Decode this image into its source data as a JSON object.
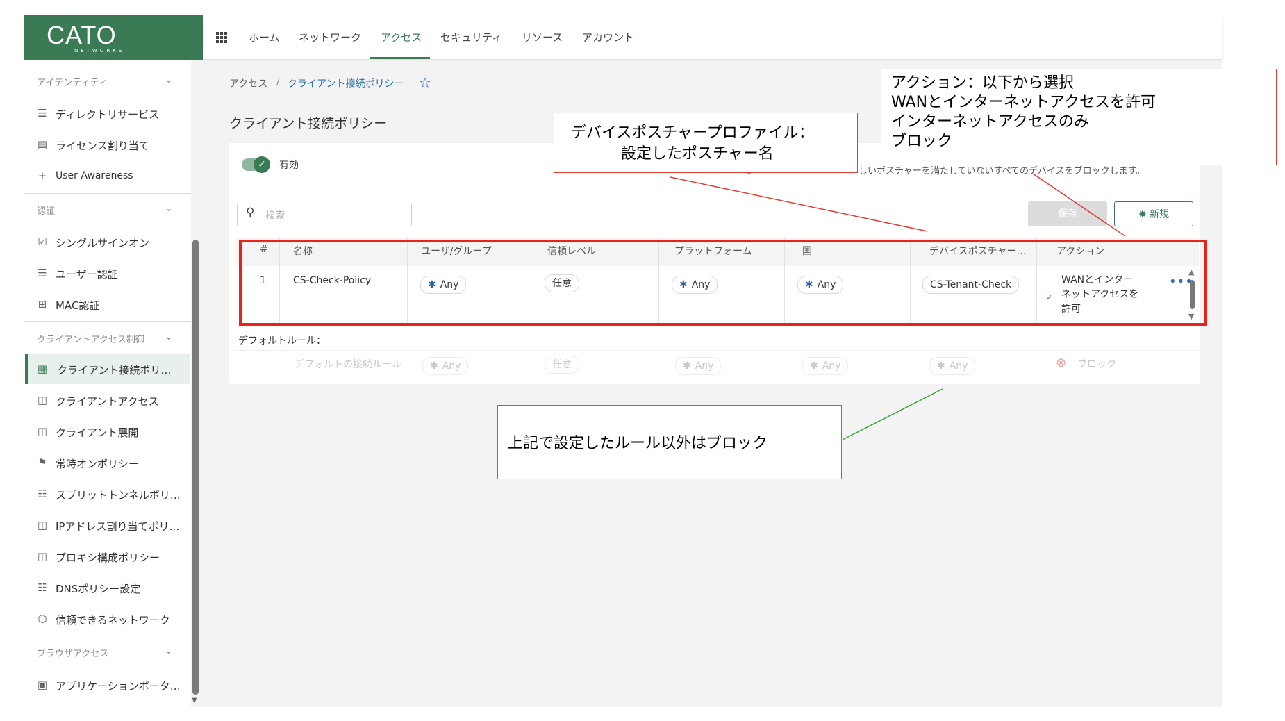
{
  "brand": {
    "name": "CATO",
    "sub": "NETWORKS",
    "color": "#3a7a55"
  },
  "topnav": {
    "items": [
      "ホーム",
      "ネットワーク",
      "アクセス",
      "セキュリティ",
      "リソース",
      "アカウント"
    ],
    "active": "アクセス"
  },
  "sidebar": {
    "sections": {
      "identity": "アイデンティティ",
      "auth": "認証",
      "client_access_control": "クライアントアクセス制御",
      "browser_access": "ブラウザアクセス"
    },
    "items": {
      "directory": "ディレクトリサービス",
      "license": "ライセンス割り当て",
      "user_awareness": "User Awareness",
      "sso": "シングルサインオン",
      "user_auth": "ユーザー認証",
      "mac_auth": "MAC認証",
      "client_conn_policy": "クライアント接続ポリ…",
      "client_access": "クライアントアクセス",
      "client_deploy": "クライアント展開",
      "always_on": "常時オンポリシー",
      "split_tunnel": "スプリットトンネルポリ…",
      "ip_assign": "IPアドレス割り当てポリ…",
      "proxy_config": "プロキシ構成ポリシー",
      "dns_policy": "DNSポリシー設定",
      "trusted_network": "信頼できるネットワーク",
      "app_portal": "アプリケーションポータ…"
    }
  },
  "breadcrumb": {
    "root": "アクセス",
    "sep": "/",
    "current": "クライアント接続ポリシー"
  },
  "page": {
    "title": "クライアント接続ポリシー",
    "enabled_label": "有効",
    "hint_text": "しいポスチャーを満たしていないすべてのデバイスをブロックします。",
    "search_placeholder": "検索",
    "save_label": "保存",
    "new_label": "新規"
  },
  "table": {
    "headers": [
      "#",
      "名称",
      "ユーザ/グループ",
      "信頼レベル",
      "プラットフォーム",
      "国",
      "デバイスポスチャー…",
      "アクション"
    ],
    "rows": [
      {
        "num": "1",
        "name": "CS-Check-Policy",
        "users": "Any",
        "trust": "任意",
        "platform": "Any",
        "country": "Any",
        "posture": "CS-Tenant-Check",
        "action_l1": "WANとインター",
        "action_l2": "ネットアクセスを",
        "action_l3": "許可"
      }
    ],
    "default_label": "デフォルトルール：",
    "default_row": {
      "name": "デフォルトの接続ルール",
      "users": "Any",
      "trust": "任意",
      "platform": "Any",
      "country": "Any",
      "posture": "Any",
      "action": "ブロック"
    }
  },
  "annotations": {
    "posture_box": {
      "line1": "デバイスポスチャープロファイル：",
      "line2": "設定したポスチャー名"
    },
    "action_box": {
      "line1": "アクション：以下から選択",
      "line2": "WANとインターネットアクセスを許可",
      "line3": "インターネットアクセスのみ",
      "line4": "ブロック"
    },
    "default_box": "上記で設定したルール以外はブロック",
    "red": "#e03b2e",
    "green": "#41a03c"
  }
}
